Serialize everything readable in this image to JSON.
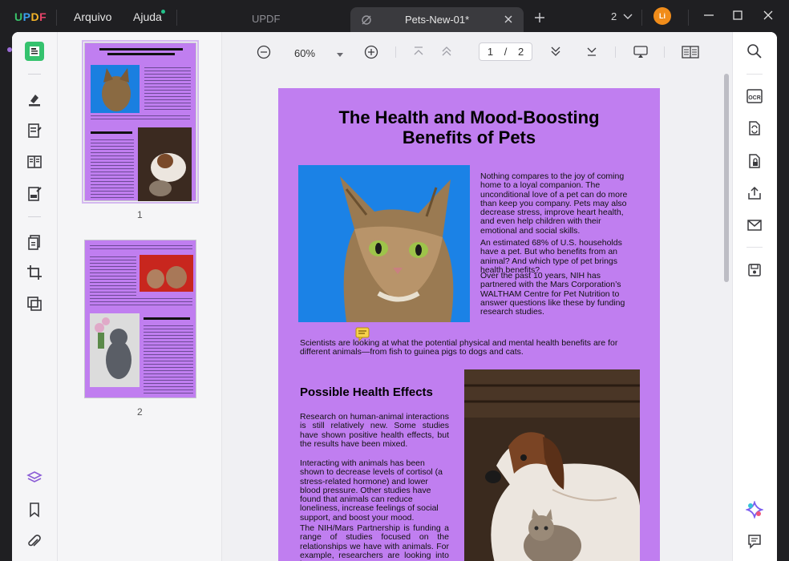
{
  "app": {
    "logo": "UPDF",
    "menu": [
      "Arquivo",
      "Ajuda"
    ],
    "tab_inactive": "UPDF",
    "tab_active": "Pets-New-01*",
    "tab_count": "2",
    "avatar_initials": "Li"
  },
  "toolbar": {
    "zoom": "60%",
    "page_current": "1",
    "page_sep": "/",
    "page_total": "2"
  },
  "thumbnails": [
    {
      "label": "1",
      "selected": true
    },
    {
      "label": "2",
      "selected": false
    }
  ],
  "page": {
    "title_line1": "The Health and Mood-Boosting",
    "title_line2": "Benefits of Pets",
    "para1": "Nothing compares to the joy of coming home to a loyal companion. The unconditional love of a pet can do more than keep you company. Pets may also decrease stress, improve heart health, and even help children with their emotional and social skills.",
    "para2": "An estimated 68% of U.S. households have a pet. But who benefits from an animal? And which type of pet brings health benefits?",
    "para3": "Over the past 10 years, NIH has partnered with the Mars Corporation’s WALTHAM Centre for Pet Nutrition to answer questions like these by funding research studies.",
    "para4": "Scientists are looking at what the potential physical and mental health benefits are for different animals—from fish to guinea pigs to dogs and cats.",
    "heading2": "Possible Health Effects",
    "para5": "Research on human-animal interactions is still relatively new. Some studies have shown positive health effects, but the results have been mixed.",
    "para6": "Interacting with animals has been shown to decrease levels of cortisol (a stress-related hormone) and lower blood pressure. Other studies have found that animals can reduce loneliness, increase feelings of social support, and boost your mood.",
    "para7": "The NIH/Mars Partnership is funding a range of studies focused on the relationships we have with animals. For example, researchers are looking into how"
  },
  "thumb2": {
    "heading": "Animals Helping People"
  },
  "colors": {
    "page_bg": "#c07ef0",
    "accent_green": "#22c28a",
    "avatar": "#f08c1a"
  }
}
